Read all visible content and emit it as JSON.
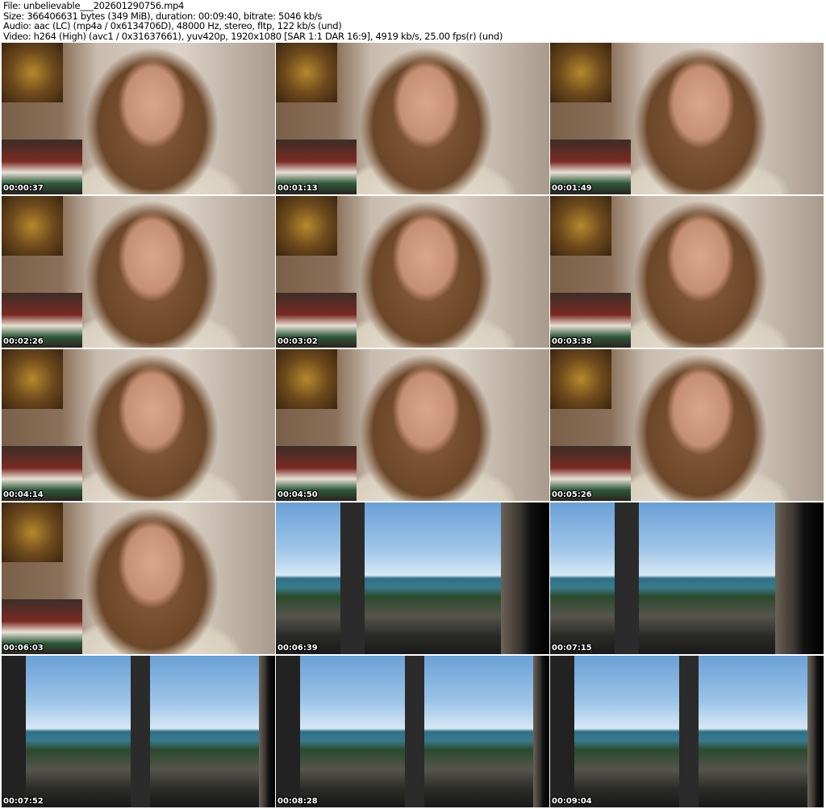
{
  "header": {
    "file": "File: unbelievable___202601290756.mp4",
    "size": "Size: 366406631 bytes (349 MiB), duration: 00:09:40, bitrate: 5046 kb/s",
    "audio": "Audio: aac (LC) (mp4a / 0x6134706D), 48000 Hz, stereo, fltp, 122 kb/s (und)",
    "video": "Video: h264 (High) (avc1 / 0x31637661), yuv420p, 1920x1080 [SAR 1:1 DAR 16:9], 4919 kb/s, 25.00 fps(r) (und)"
  },
  "thumbnails": [
    {
      "time": "00:00:37",
      "scene": "portrait"
    },
    {
      "time": "00:01:13",
      "scene": "portrait"
    },
    {
      "time": "00:01:49",
      "scene": "portrait"
    },
    {
      "time": "00:02:26",
      "scene": "portrait"
    },
    {
      "time": "00:03:02",
      "scene": "portrait"
    },
    {
      "time": "00:03:38",
      "scene": "portrait"
    },
    {
      "time": "00:04:14",
      "scene": "portrait"
    },
    {
      "time": "00:04:50",
      "scene": "portrait"
    },
    {
      "time": "00:05:26",
      "scene": "portrait"
    },
    {
      "time": "00:06:03",
      "scene": "portrait"
    },
    {
      "time": "00:06:39",
      "scene": "window"
    },
    {
      "time": "00:07:15",
      "scene": "window"
    },
    {
      "time": "00:07:52",
      "scene": "window w2"
    },
    {
      "time": "00:08:28",
      "scene": "window w2"
    },
    {
      "time": "00:09:04",
      "scene": "window w2"
    }
  ]
}
